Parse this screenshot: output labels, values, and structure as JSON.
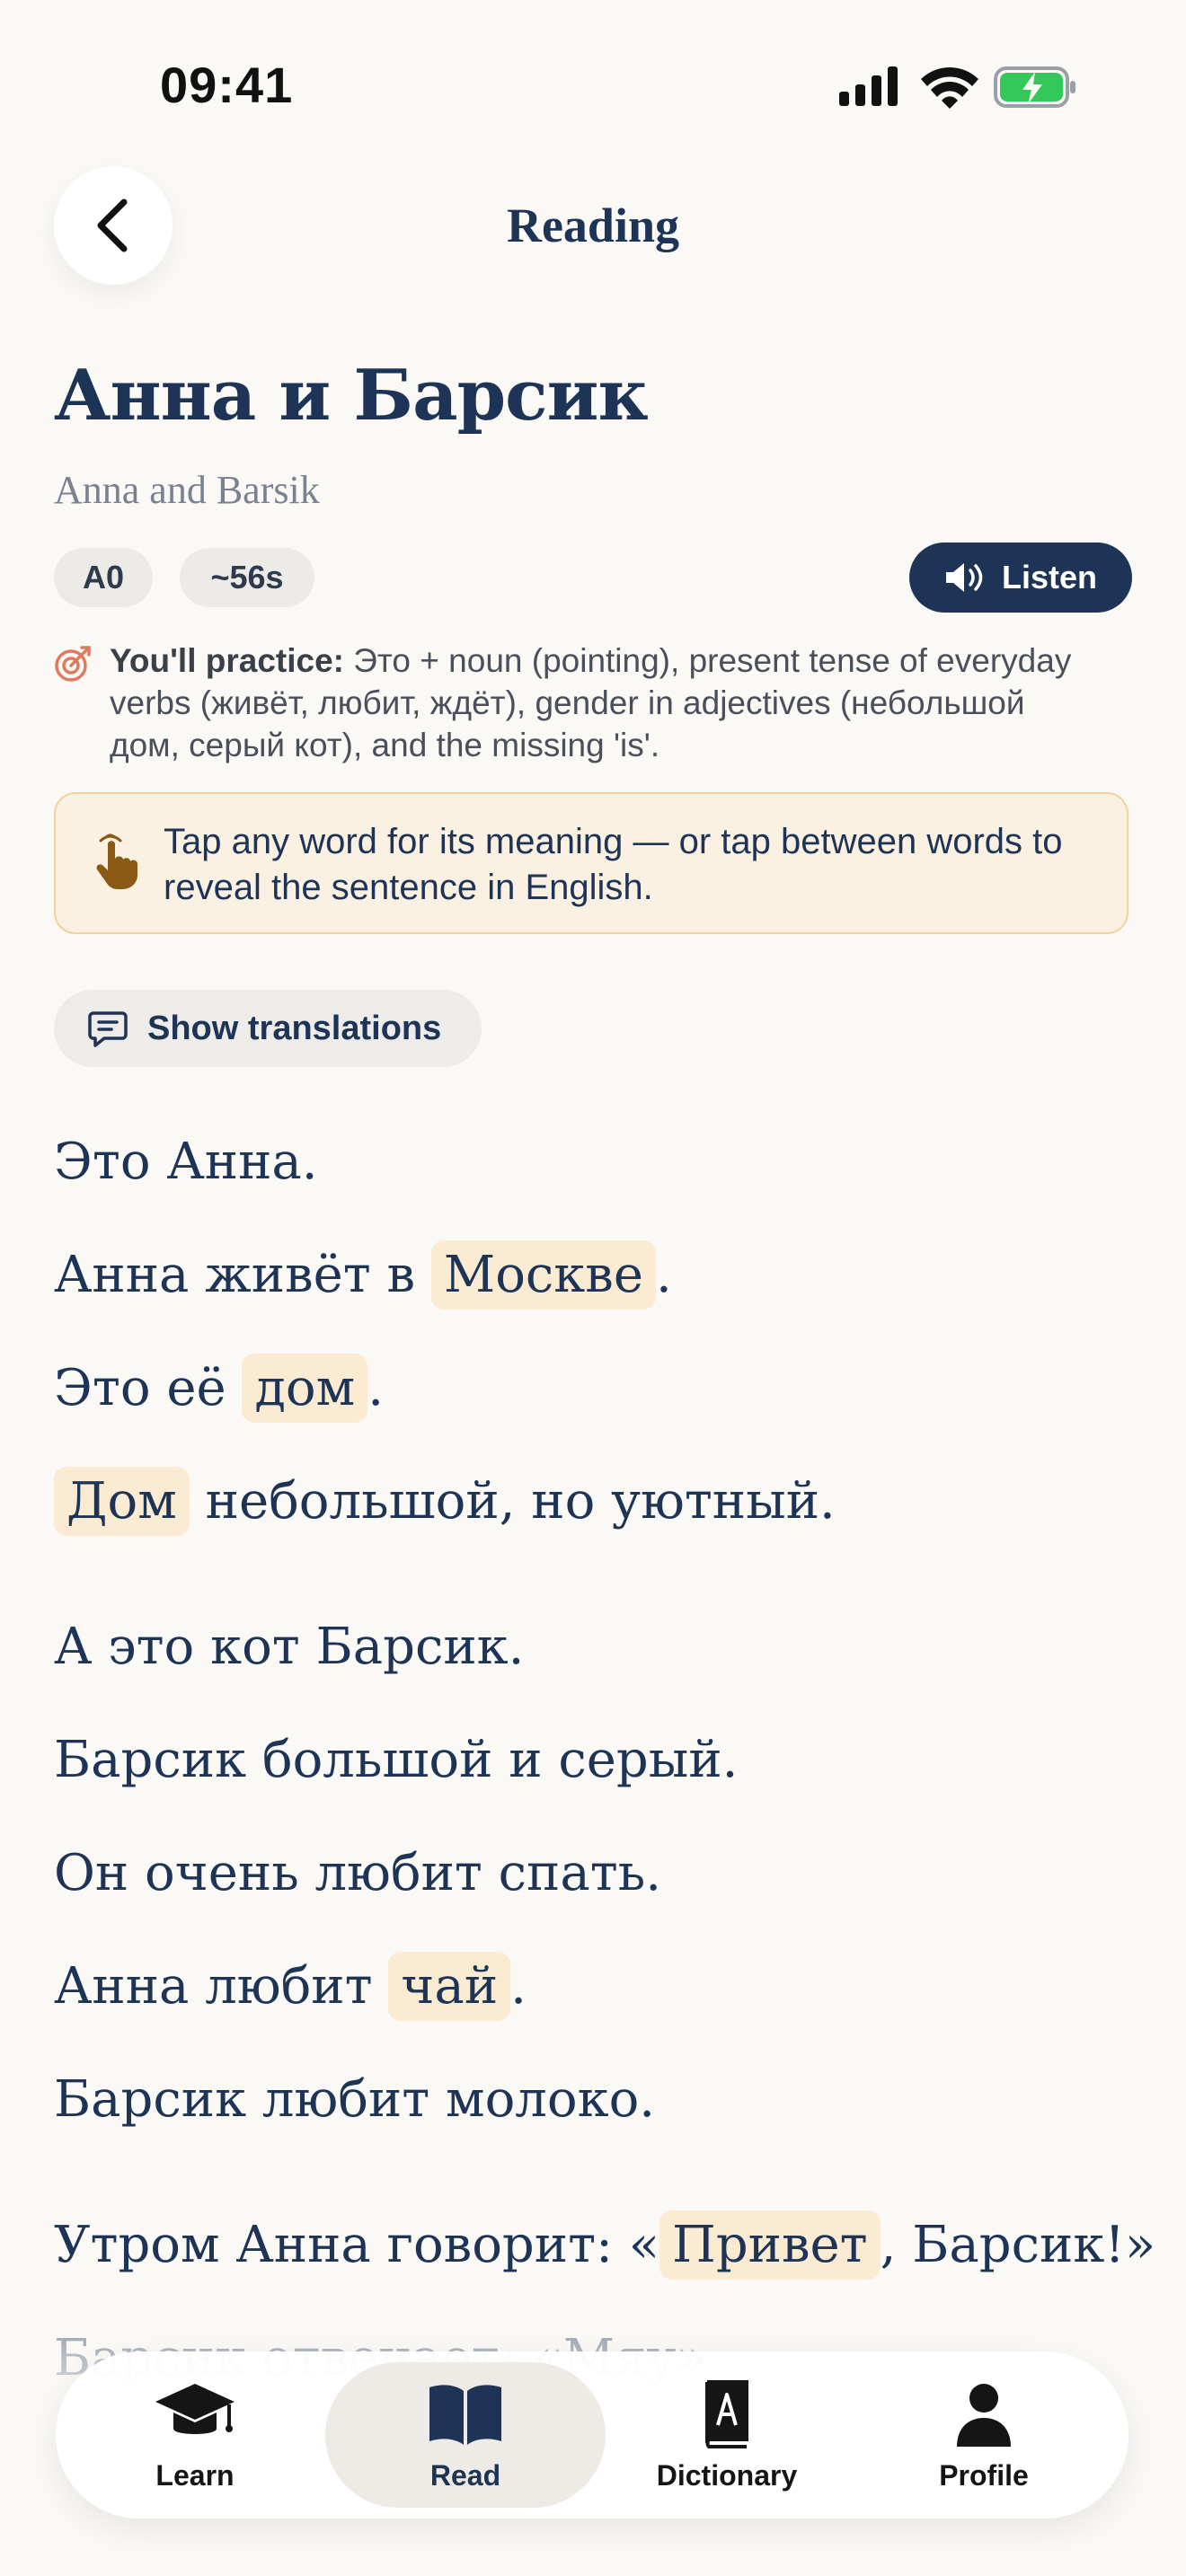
{
  "status": {
    "time": "09:41"
  },
  "header": {
    "title": "Reading"
  },
  "story": {
    "title": "Анна и Барсик",
    "subtitle": "Anna and Barsik",
    "level": "A0",
    "duration": "~56s",
    "listen_label": "Listen"
  },
  "practice": {
    "label": "You'll practice:",
    "text": " Это + noun (pointing), present tense of everyday verbs (живёт, любит, ждёт), gender in adjectives (небольшой дом, серый кот), and the missing 'is'."
  },
  "hint": {
    "text": "Tap any word for its meaning — or tap between words to reveal the sentence in English."
  },
  "show_translations_label": "Show translations",
  "lines": {
    "l1": {
      "a": "Это Анна."
    },
    "l2": {
      "a": "Анна живёт в ",
      "w": "Москве",
      "b": "."
    },
    "l3": {
      "a": "Это её ",
      "w": "дом",
      "b": "."
    },
    "l4": {
      "w": "Дом",
      "b": " небольшой, но уютный."
    },
    "l5": {
      "a": "А это кот Барсик."
    },
    "l6": {
      "a": "Барсик большой и серый."
    },
    "l7": {
      "a": "Он очень любит спать."
    },
    "l8": {
      "a": "Анна любит ",
      "w": "чай",
      "b": "."
    },
    "l9": {
      "a": "Барсик любит молоко."
    },
    "l10": {
      "a": "Утром Анна говорит: «",
      "w": "Привет",
      "b": ", Барсик!»"
    },
    "l11": {
      "a": "Барсик отвечает: «Мяу»"
    }
  },
  "nav": {
    "learn": "Learn",
    "read": "Read",
    "dictionary": "Dictionary",
    "profile": "Profile"
  },
  "colors": {
    "navy": "#1E3457",
    "highlight": "#FBEBD3",
    "hint_bg": "#FBF1E2",
    "battery_green": "#34C759",
    "background": "#FBF9F6"
  }
}
